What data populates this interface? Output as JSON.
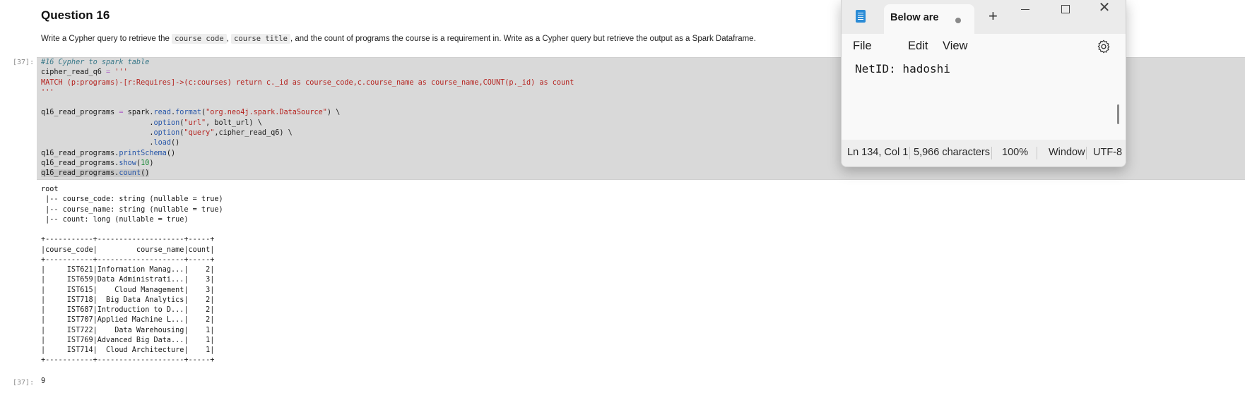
{
  "notebook": {
    "question_title": "Question 16",
    "description": {
      "part1": "Write a Cypher query to retrieve the ",
      "code1": "course code",
      "part2": ", ",
      "code2": "course title",
      "part3": ", and the count of programs the course is a requirement in. Write as a Cypher query but retrieve the output as a Spark Dataframe."
    },
    "input_prompt": "[37]:",
    "output_prompt": "[37]:",
    "code_lines": [
      "#16 Cypher to spark table",
      "cipher_read_q6 = '''",
      "MATCH (p:programs)-[r:Requires]->(c:courses) return c._id as course_code,c.course_name as course_name,COUNT(p._id) as count",
      "'''",
      "",
      "q16_read_programs = spark.read.format(\"org.neo4j.spark.DataSource\") \\",
      "                         .option(\"url\", bolt_url) \\",
      "                         .option(\"query\",cipher_read_q6) \\",
      "                         .load()",
      "q16_read_programs.printSchema()",
      "q16_read_programs.show(10)",
      "q16_read_programs.count()"
    ],
    "output_lines": [
      "root",
      " |-- course_code: string (nullable = true)",
      " |-- course_name: string (nullable = true)",
      " |-- count: long (nullable = true)",
      "",
      "+-----------+--------------------+-----+",
      "|course_code|         course_name|count|",
      "+-----------+--------------------+-----+",
      "|     IST621|Information Manag...|    2|",
      "|     IST659|Data Administrati...|    3|",
      "|     IST615|    Cloud Management|    3|",
      "|     IST718|  Big Data Analytics|    2|",
      "|     IST687|Introduction to D...|    2|",
      "|     IST707|Applied Machine L...|    2|",
      "|     IST722|    Data Warehousing|    1|",
      "|     IST769|Advanced Big Data...|    1|",
      "|     IST714|  Cloud Architecture|    1|",
      "+-----------+--------------------+-----+"
    ],
    "count_result": "9"
  },
  "notepad": {
    "tab_title": "Below are",
    "new_tab": "+",
    "close_glyph": "✕",
    "menu": {
      "file": "File",
      "edit": "Edit",
      "view": "View"
    },
    "content": "NetID: hadoshi",
    "status": {
      "position": "Ln 134, Col 1",
      "characters": "5,966 characters",
      "zoom": "100%",
      "line_ending": "Window",
      "encoding": "UTF-8"
    },
    "icons": {
      "app": "notepad-icon",
      "settings": "gear-icon"
    }
  }
}
